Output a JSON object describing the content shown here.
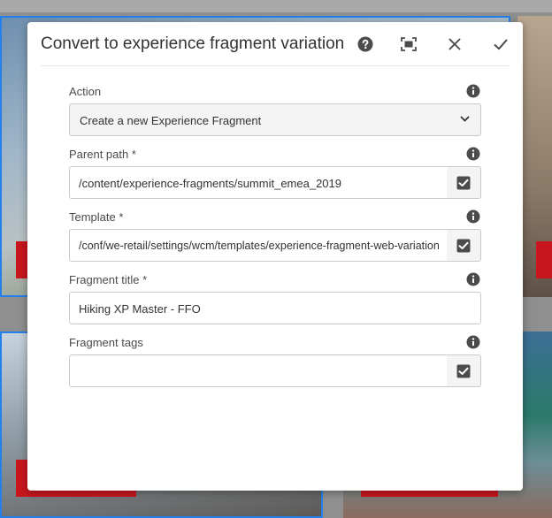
{
  "dialog": {
    "title": "Convert to experience fragment variation",
    "header_icons": [
      "help-icon",
      "fullscreen-icon",
      "close-icon",
      "checkmark-icon"
    ]
  },
  "form": {
    "action": {
      "label": "Action",
      "value": "Create a new Experience Fragment",
      "icon": "info-icon"
    },
    "parent_path": {
      "label": "Parent path *",
      "value": "/content/experience-fragments/summit_emea_2019",
      "icon": "info-icon"
    },
    "template": {
      "label": "Template *",
      "value": "/conf/we-retail/settings/wcm/templates/experience-fragment-web-variation",
      "icon": "info-icon"
    },
    "fragment_title": {
      "label": "Fragment title *",
      "value": "Hiking XP Master - FFO",
      "icon": "info-icon"
    },
    "fragment_tags": {
      "label": "Fragment tags",
      "value": "",
      "icon": "info-icon"
    }
  },
  "colors": {
    "accent_red": "#c8161e",
    "selection_blue": "#2680eb",
    "icon_gray": "#4b4b4b"
  }
}
